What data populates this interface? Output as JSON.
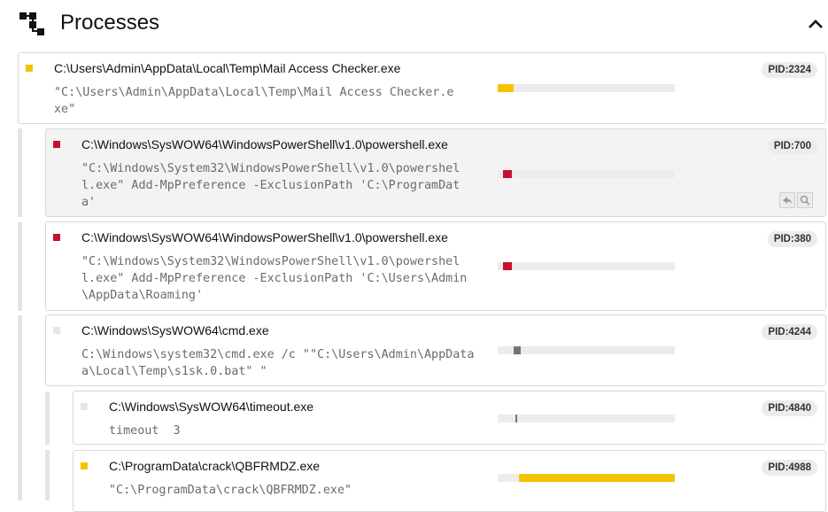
{
  "header": {
    "title": "Processes"
  },
  "colors": {
    "warning": "#f5c400",
    "danger": "#c8102e",
    "neutral": "#e6e6e6",
    "marker": "#6c7680"
  },
  "processes": [
    {
      "path": "C:\\Users\\Admin\\AppData\\Local\\Temp\\Mail Access Checker.exe",
      "cmd_lines": [
        "\"C:\\Users\\Admin\\AppData\\Local\\Temp\\Mail Access Checker.e",
        "xe\""
      ],
      "pid": "PID:2324",
      "severity": "warning",
      "timeline": {
        "start": 0.0,
        "end": 0.09
      }
    },
    {
      "path": "C:\\Windows\\SysWOW64\\WindowsPowerShell\\v1.0\\powershell.exe",
      "cmd_lines": [
        "\"C:\\Windows\\System32\\WindowsPowerShell\\v1.0\\powershel",
        "l.exe\" Add-MpPreference -ExclusionPath 'C:\\ProgramDat",
        "a'"
      ],
      "pid": "PID:700",
      "severity": "danger",
      "timeline": {
        "start": 0.03,
        "end": 0.08
      }
    },
    {
      "path": "C:\\Windows\\SysWOW64\\WindowsPowerShell\\v1.0\\powershell.exe",
      "cmd_lines": [
        "\"C:\\Windows\\System32\\WindowsPowerShell\\v1.0\\powershel",
        "l.exe\" Add-MpPreference -ExclusionPath 'C:\\Users\\Admin",
        "\\AppData\\Roaming'"
      ],
      "pid": "PID:380",
      "severity": "danger",
      "timeline": {
        "start": 0.03,
        "end": 0.08
      }
    },
    {
      "path": "C:\\Windows\\SysWOW64\\cmd.exe",
      "cmd_lines": [
        "C:\\Windows\\system32\\cmd.exe /c \"\"C:\\Users\\Admin\\AppData",
        "a\\Local\\Temp\\s1sk.0.bat\" \""
      ],
      "pid": "PID:4244",
      "severity": "neutral",
      "timeline": {
        "start": 0.09,
        "end": 0.13
      }
    },
    {
      "path": "C:\\Windows\\SysWOW64\\timeout.exe",
      "cmd_lines": [
        "timeout  3"
      ],
      "pid": "PID:4840",
      "severity": "neutral",
      "timeline": {
        "start": 0.1,
        "end": 0.11
      }
    },
    {
      "path": "C:\\ProgramData\\crack\\QBFRMDZ.exe",
      "cmd_lines": [
        "\"C:\\ProgramData\\crack\\QBFRMDZ.exe\""
      ],
      "pid": "PID:4988",
      "severity": "warning",
      "timeline": {
        "start": 0.12,
        "end": 1.0
      }
    }
  ]
}
